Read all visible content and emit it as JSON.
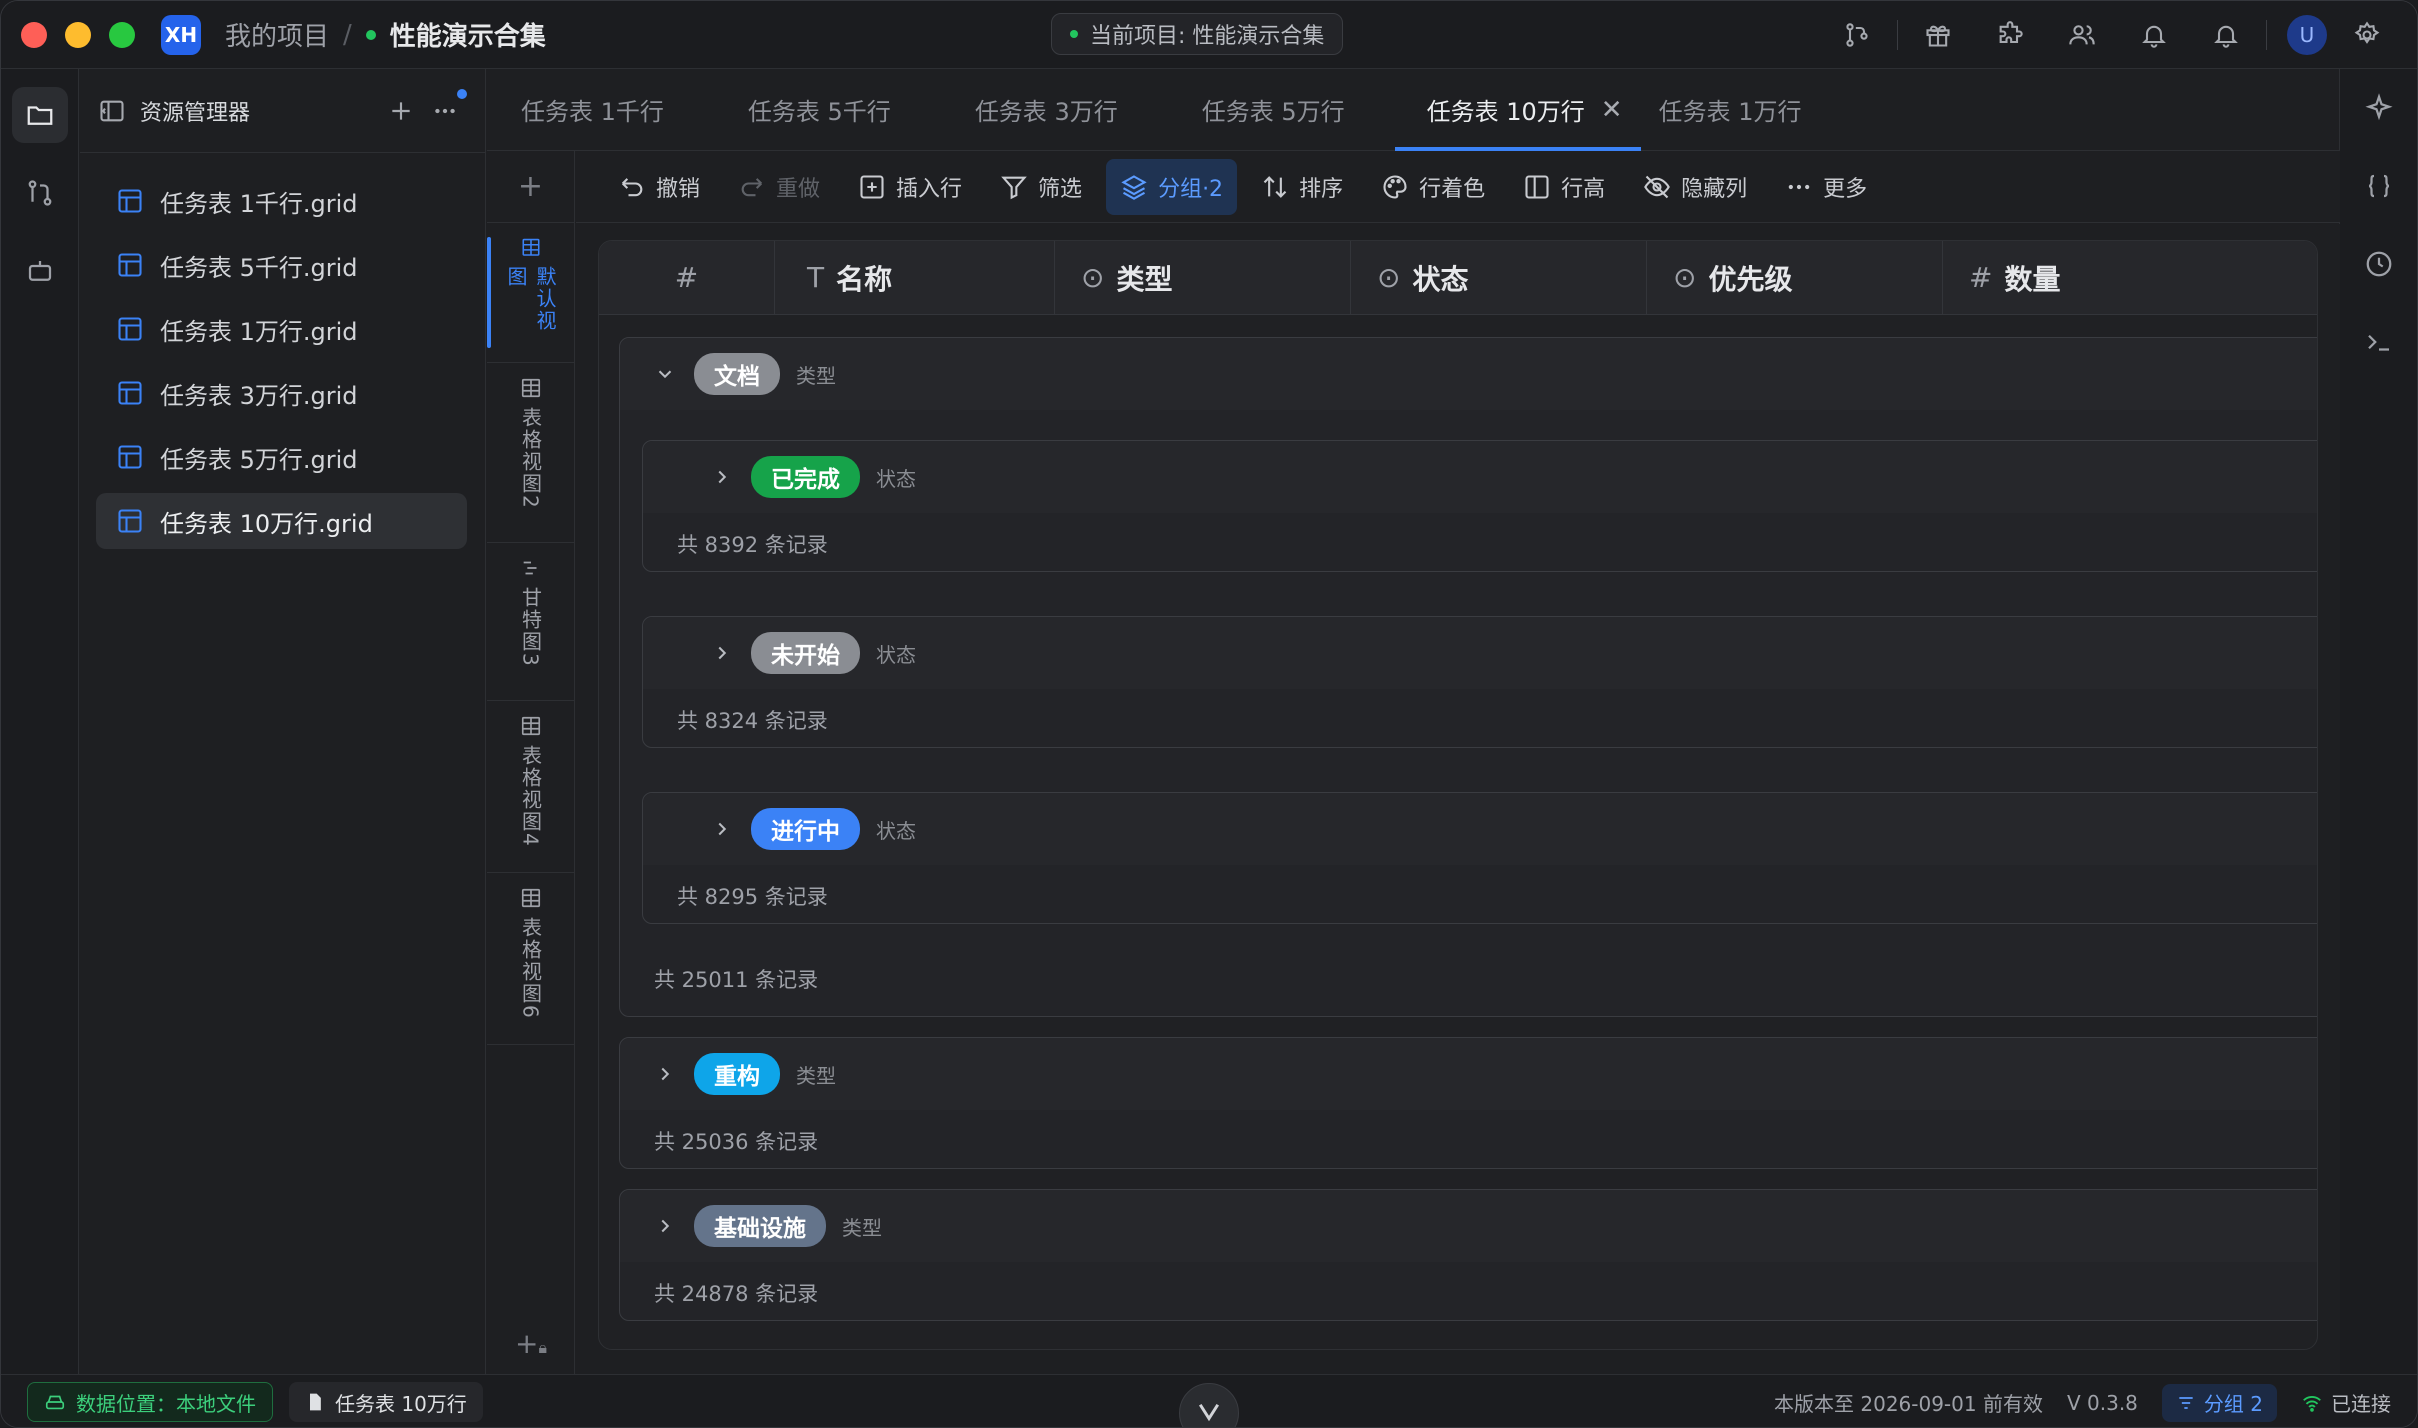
{
  "titlebar": {
    "logo": "XH",
    "breadcrumb_root": "我的项目",
    "breadcrumb_sep": "/",
    "project_name": "性能演示合集",
    "center_label": "当前项目: 性能演示合集",
    "avatar": "U"
  },
  "explorer": {
    "title": "资源管理器",
    "files": [
      {
        "name": "任务表 1千行.grid"
      },
      {
        "name": "任务表 5千行.grid"
      },
      {
        "name": "任务表 1万行.grid"
      },
      {
        "name": "任务表 3万行.grid"
      },
      {
        "name": "任务表 5万行.grid"
      },
      {
        "name": "任务表 10万行.grid"
      }
    ]
  },
  "tabs": [
    {
      "label": "任务表 1千行"
    },
    {
      "label": "任务表 5千行"
    },
    {
      "label": "任务表 3万行"
    },
    {
      "label": "任务表 5万行"
    },
    {
      "label": "任务表 10万行"
    },
    {
      "label": "任务表 1万行"
    }
  ],
  "tab_close": "✕",
  "views": [
    {
      "label": "默认视图"
    },
    {
      "label": "表格视图2"
    },
    {
      "label": "甘特图3"
    },
    {
      "label": "表格视图4"
    },
    {
      "label": "表格视图6"
    }
  ],
  "toolbar": {
    "undo": "撤销",
    "redo": "重做",
    "insert_row": "插入行",
    "filter": "筛选",
    "group": "分组·2",
    "sort": "排序",
    "row_color": "行着色",
    "row_height": "行高",
    "hide_cols": "隐藏列",
    "more": "更多"
  },
  "grid": {
    "columns": [
      {
        "label": "#",
        "icon": ""
      },
      {
        "label": "名称",
        "icon": "T"
      },
      {
        "label": "类型",
        "icon": "⊙"
      },
      {
        "label": "状态",
        "icon": "⊙"
      },
      {
        "label": "优先级",
        "icon": "⊙"
      },
      {
        "label": "数量",
        "icon": "#"
      }
    ],
    "groups": [
      {
        "label": "文档",
        "field": "类型",
        "color": "#8a8d93",
        "footer": "共 25011 条记录",
        "subgroups": [
          {
            "label": "已完成",
            "field": "状态",
            "color": "#16a34a",
            "footer": "共 8392 条记录"
          },
          {
            "label": "未开始",
            "field": "状态",
            "color": "#8a8d93",
            "footer": "共 8324 条记录"
          },
          {
            "label": "进行中",
            "field": "状态",
            "color": "#3b82f6",
            "footer": "共 8295 条记录"
          }
        ]
      },
      {
        "label": "重构",
        "field": "类型",
        "color": "#0ea5e9",
        "footer": "共 25036 条记录"
      },
      {
        "label": "基础设施",
        "field": "类型",
        "color": "#64748b",
        "footer": "共 24878 条记录"
      }
    ]
  },
  "statusbar": {
    "location": "数据位置：本地文件",
    "file": "任务表 10万行",
    "license": "本版本至 2026-09-01 前有效",
    "version": "V 0.3.8",
    "group": "分组 2",
    "connection": "已连接"
  }
}
